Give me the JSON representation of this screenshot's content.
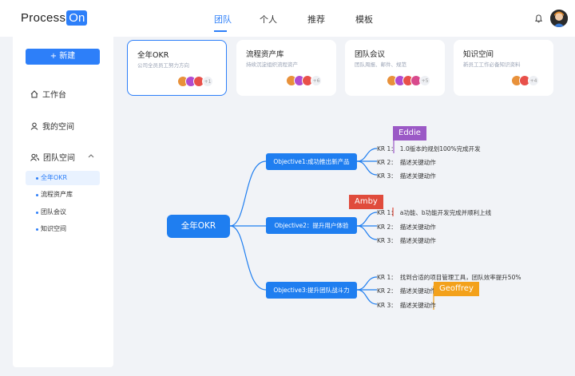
{
  "header": {
    "logo_text": "Process",
    "logo_box": "On",
    "nav": [
      "团队",
      "个人",
      "推荐",
      "模板"
    ],
    "active_nav": "团队"
  },
  "sidebar": {
    "new_button": "+ 新建",
    "items": [
      {
        "label": "工作台",
        "icon": "home-icon"
      },
      {
        "label": "我的空间",
        "icon": "user-icon"
      },
      {
        "label": "团队空间",
        "icon": "team-icon"
      }
    ],
    "sub_items": [
      "全年OKR",
      "流程资产库",
      "团队会议",
      "知识空间"
    ],
    "active_sub": "全年OKR"
  },
  "cards": [
    {
      "title": "全年OKR",
      "desc": "公司全员员工努力方向",
      "more": "+1",
      "active": true
    },
    {
      "title": "流程资产库",
      "desc": "持续沉淀组织流程资产",
      "more": "+6",
      "active": false
    },
    {
      "title": "团队会议",
      "desc": "团队周报、邮件、规范",
      "more": "+5",
      "active": false
    },
    {
      "title": "知识空间",
      "desc": "新员工工作必备知识资料",
      "more": "+4",
      "active": false
    }
  ],
  "mindmap": {
    "root": "全年OKR",
    "objectives": [
      {
        "label": "Objective1:成功推出新产品",
        "krs": [
          {
            "k": "KR 1：",
            "t": "1.0版本的规划100%完成开发"
          },
          {
            "k": "KR 2：",
            "t": "描述关键动作"
          },
          {
            "k": "KR 3：",
            "t": "描述关键动作"
          }
        ]
      },
      {
        "label": "Objective2：提升用户体验",
        "krs": [
          {
            "k": "KR 1：",
            "t": "a功能、b功能开发完成并顺利上线"
          },
          {
            "k": "KR 2：",
            "t": "描述关键动作"
          },
          {
            "k": "KR 3：",
            "t": "描述关键动作"
          }
        ]
      },
      {
        "label": "Objective3:提升团队战斗力",
        "krs": [
          {
            "k": "KR 1：",
            "t": "找到合适的项目管理工具，团队效率提升50%"
          },
          {
            "k": "KR 2：",
            "t": "描述关键动作"
          },
          {
            "k": "KR 3：",
            "t": "描述关键动作"
          }
        ]
      }
    ]
  },
  "collaborators": [
    {
      "name": "Eddie",
      "color": "#9b59c6"
    },
    {
      "name": "Amby",
      "color": "#e04b3c"
    },
    {
      "name": "Geoffrey",
      "color": "#f3a11b"
    }
  ],
  "colors": {
    "accent": "#2d7ff9",
    "node": "#1f7ef0"
  }
}
